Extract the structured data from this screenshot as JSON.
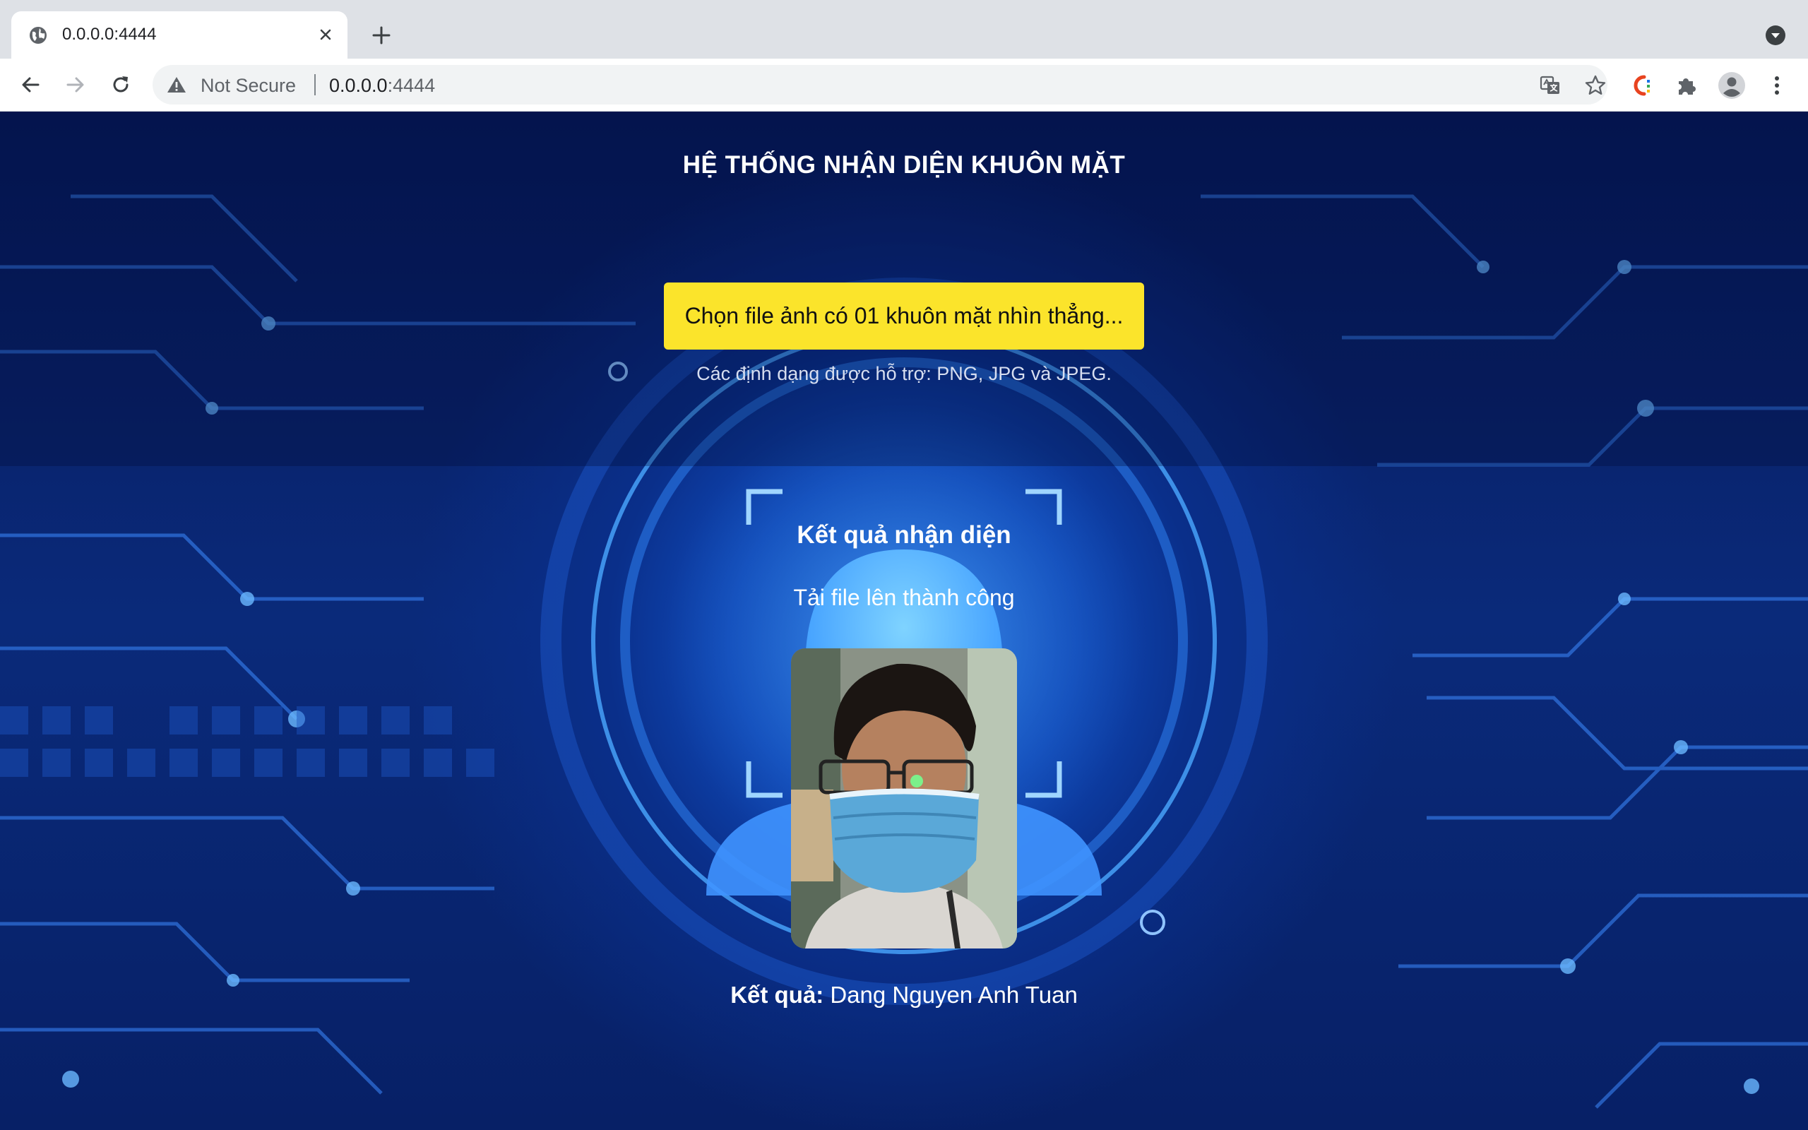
{
  "browser": {
    "tab_title": "0.0.0.0:4444",
    "security_label": "Not Secure",
    "url_host": "0.0.0.0",
    "url_port": ":4444"
  },
  "page": {
    "title": "HỆ THỐNG NHẬN DIỆN KHUÔN MẶT",
    "choose_button_label": "Chọn file ảnh có 01 khuôn mặt nhìn thẳng...",
    "formats_note": "Các định dạng được hỗ trợ: PNG, JPG và JPEG.",
    "result_heading": "Kết quả nhận diện",
    "upload_status": "Tải file lên thành công",
    "result_label": "Kết quả:",
    "result_value": "Dang Nguyen Anh Tuan"
  },
  "colors": {
    "accent_button": "#fbe42b",
    "page_background": "#0a2a7a"
  }
}
